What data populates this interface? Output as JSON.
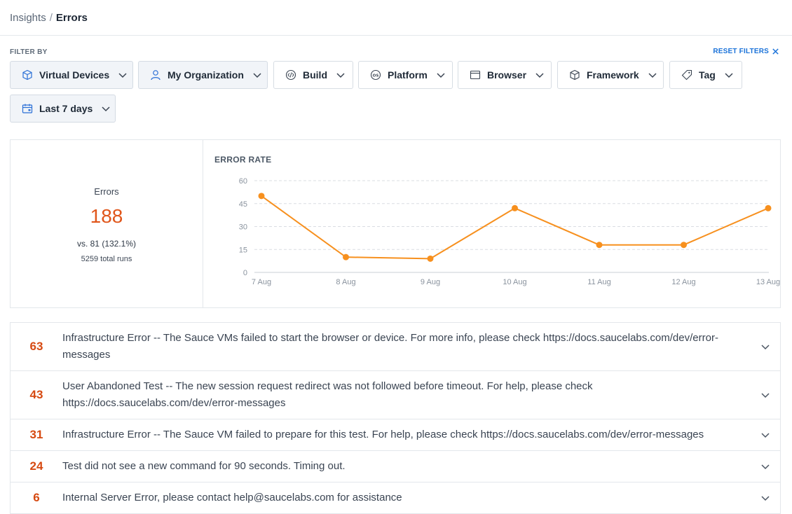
{
  "breadcrumb": {
    "parent": "Insights",
    "separator": "/",
    "current": "Errors"
  },
  "filters": {
    "label": "FILTER BY",
    "reset_label": "RESET FILTERS",
    "buttons": [
      {
        "label": "Virtual Devices",
        "icon": "cube-icon",
        "active": true
      },
      {
        "label": "My Organization",
        "icon": "user-icon",
        "active": true
      },
      {
        "label": "Build",
        "icon": "build-icon",
        "active": false
      },
      {
        "label": "Platform",
        "icon": "os-icon",
        "active": false
      },
      {
        "label": "Browser",
        "icon": "browser-window-icon",
        "active": false
      },
      {
        "label": "Framework",
        "icon": "cube-icon",
        "active": false
      },
      {
        "label": "Tag",
        "icon": "tag-icon",
        "active": false
      },
      {
        "label": "Last 7 days",
        "icon": "calendar-icon",
        "active": true
      }
    ]
  },
  "summary": {
    "label": "Errors",
    "value": "188",
    "comparison": "vs. 81 (132.1%)",
    "total_runs": "5259 total runs"
  },
  "chart_data": {
    "type": "line",
    "title": "ERROR RATE",
    "categories": [
      "7 Aug",
      "8 Aug",
      "9 Aug",
      "10 Aug",
      "11 Aug",
      "12 Aug",
      "13 Aug"
    ],
    "series": [
      {
        "values": [
          50,
          10,
          9,
          42,
          18,
          18,
          42
        ]
      }
    ],
    "ylim": [
      0,
      60
    ],
    "yticks": [
      0,
      15,
      30,
      45,
      60
    ],
    "grid": true,
    "line_color": "#f7901e"
  },
  "errors": [
    {
      "count": "63",
      "message": "Infrastructure Error -- The Sauce VMs failed to start the browser or device. For more info, please check https://docs.saucelabs.com/dev/error-messages"
    },
    {
      "count": "43",
      "message": "User Abandoned Test -- The new session request redirect was not followed before timeout. For help, please check https://docs.saucelabs.com/dev/error-messages"
    },
    {
      "count": "31",
      "message": "Infrastructure Error -- The Sauce VM failed to prepare for this test. For help, please check https://docs.saucelabs.com/dev/error-messages"
    },
    {
      "count": "24",
      "message": "Test did not see a new command for 90 seconds. Timing out."
    },
    {
      "count": "6",
      "message": "Internal Server Error, please contact help@saucelabs.com for assistance"
    }
  ],
  "colors": {
    "accent": "#e0561b",
    "link": "#1a72d9",
    "line": "#f7901e"
  }
}
